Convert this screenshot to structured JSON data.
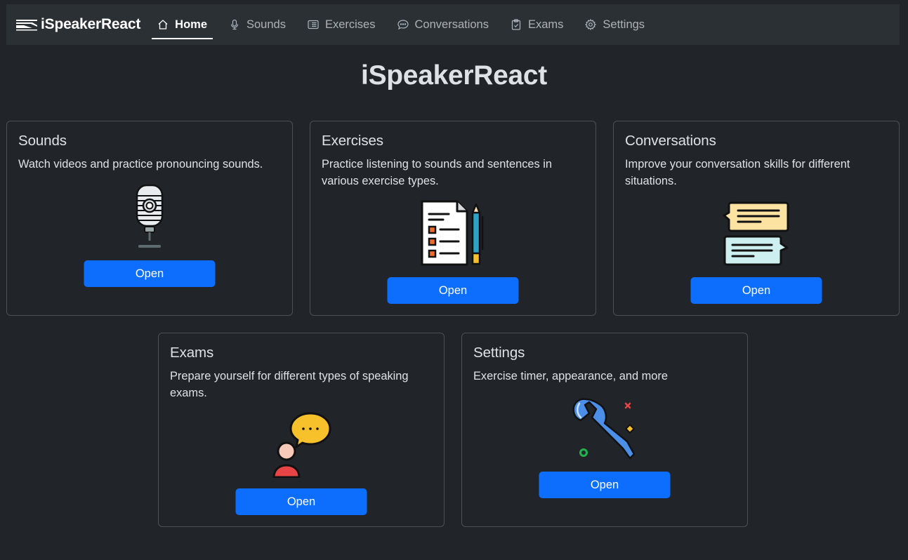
{
  "navbar": {
    "brand": "iSpeakerReact",
    "items": [
      {
        "label": "Home",
        "icon": "home-icon",
        "active": true
      },
      {
        "label": "Sounds",
        "icon": "microphone-icon",
        "active": false
      },
      {
        "label": "Exercises",
        "icon": "card-list-icon",
        "active": false
      },
      {
        "label": "Conversations",
        "icon": "chat-dots-icon",
        "active": false
      },
      {
        "label": "Exams",
        "icon": "clipboard-check-icon",
        "active": false
      },
      {
        "label": "Settings",
        "icon": "gear-icon",
        "active": false
      }
    ]
  },
  "main": {
    "title": "iSpeakerReact",
    "cards": [
      {
        "title": "Sounds",
        "description": "Watch videos and practice pronouncing sounds.",
        "button": "Open",
        "icon": "microphone-illustration"
      },
      {
        "title": "Exercises",
        "description": "Practice listening to sounds and sentences in various exercise types.",
        "button": "Open",
        "icon": "checklist-pencil-illustration"
      },
      {
        "title": "Conversations",
        "description": "Improve your conversation skills for different situations.",
        "button": "Open",
        "icon": "speech-bubbles-illustration"
      },
      {
        "title": "Exams",
        "description": "Prepare yourself for different types of speaking exams.",
        "button": "Open",
        "icon": "speaker-person-illustration"
      },
      {
        "title": "Settings",
        "description": "Exercise timer, appearance, and more",
        "button": "Open",
        "icon": "wrench-illustration"
      }
    ]
  },
  "colors": {
    "background": "#212529",
    "navbar": "#2b3035",
    "accent": "#0d6efd",
    "card_border": "#495057"
  }
}
